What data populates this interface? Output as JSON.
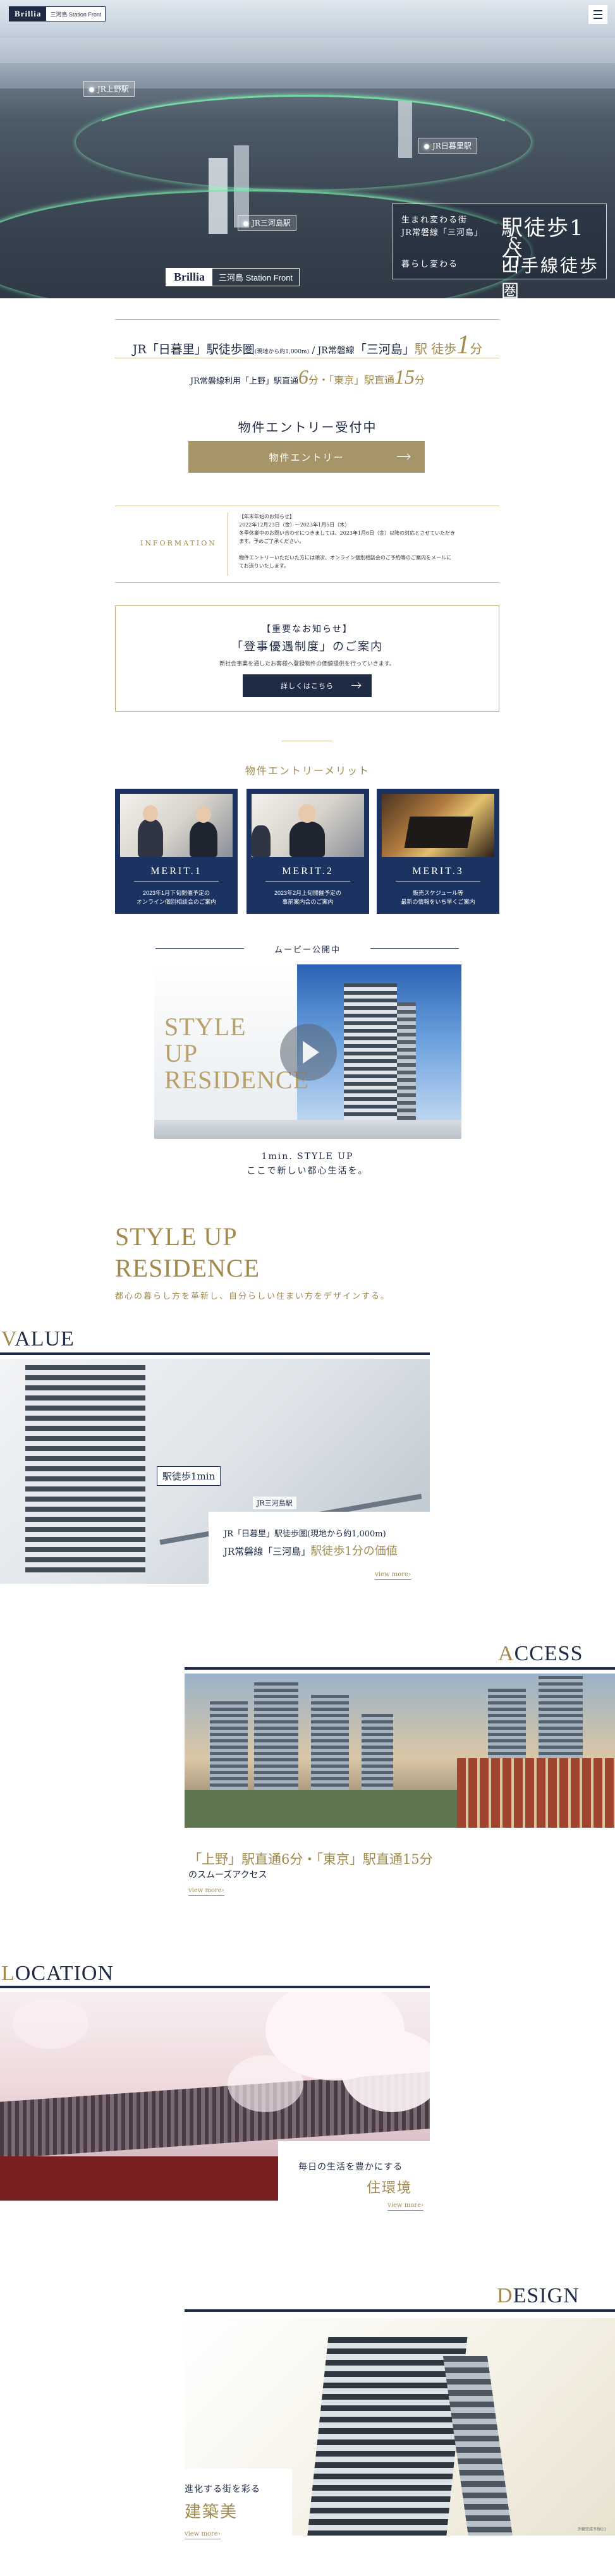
{
  "header": {
    "brand": "Brillia",
    "brand_sub": "三河島 Station Front",
    "menu_icon": "hamburger-icon"
  },
  "hero": {
    "stations": [
      "JR上野駅",
      "JR日暮里駅",
      "JR三河島駅"
    ],
    "copy_line1": "生まれ変わる街",
    "copy_line2": "JR常磐線「三河島」",
    "copy_big1": "駅徒歩1分",
    "copy_amp": "&",
    "copy_line3": "暮らし変わる",
    "copy_big2": "山手線徒歩圏",
    "brand": "Brillia",
    "brand_sub": "三河島 Station Front"
  },
  "access_line1": {
    "a": "JR「日暮里」駅徒歩圏",
    "a_note": "(現地から約1,000m)",
    "b": "/ JR常磐線",
    "c": "「三河島」",
    "d": "駅 徒歩",
    "e": "1",
    "f": "分"
  },
  "access_line2": {
    "a": "JR常磐線利用「上野」駅直通",
    "b": "6",
    "c": "分・「東京」駅直通",
    "d": "15",
    "e": "分"
  },
  "entry": {
    "heading": "物件エントリー受付中",
    "button_label": "物件エントリー"
  },
  "information": {
    "label": "INFORMATION",
    "lines": [
      "【年末年始のお知らせ】",
      "2022年12月23日（金）～2023年1月5日（木）",
      "冬季休業中のお問い合わせにつきましては、2023年1月6日（金）以降の対応とさせていただき",
      "ます。予めご了承ください。",
      "",
      "物件エントリーいただいた方には順次、オンライン個別相談会のご予約等のご案内をメールに",
      "てお送りいたします。"
    ]
  },
  "notice": {
    "small": "【重要なお知らせ】",
    "title": "「登事優遇制度」のご案内",
    "desc": "新社会事業を通したお客様へ登録物件の価値提供を行っていきます。",
    "button_label": "詳しくはこちら"
  },
  "merit": {
    "heading": "物件エントリーメリット",
    "items": [
      {
        "title": "MERIT.1",
        "d1": "2023年1月下旬開催予定の",
        "d2": "オンライン個別相談会のご案内"
      },
      {
        "title": "MERIT.2",
        "d1": "2023年2月上旬開催予定の",
        "d2": "事前案内会のご案内"
      },
      {
        "title": "MERIT.3",
        "d1": "販売スケジュール等",
        "d2": "最新の情報をいち早くご案内"
      }
    ]
  },
  "movie": {
    "heading": "ムービー公開中",
    "overlay": "STYLE\nUP\nRESIDENCE",
    "caption1": "1min. STYLE UP",
    "caption2": "ここで新しい都心生活を。"
  },
  "style_up": {
    "title_line1": "STYLE UP",
    "title_line2": "RESIDENCE",
    "sub": "都心の暮らし方を革新し、自分らしい住まい方をデザインする。"
  },
  "value": {
    "title_cap": "V",
    "title_rest": "ALUE",
    "tag": "駅徒歩1min",
    "tag2": "JR三河島駅",
    "c1": "JR「日暮里」駅徒歩圏(現地から約1,000m)",
    "c2a": "JR常磐線「三河島」",
    "c2b": "駅徒歩1分の価値",
    "more": "view more›"
  },
  "access": {
    "title_cap": "A",
    "title_rest": "CCESS",
    "c1": "「上野」駅直通6分・「東京」駅直通15分",
    "c2": "のスムーズアクセス",
    "more": "view more›"
  },
  "location": {
    "title_cap": "L",
    "title_rest": "OCATION",
    "c1": "毎日の生活を豊かにする",
    "c2": "住環境",
    "more": "view more›"
  },
  "design": {
    "title_cap": "D",
    "title_rest": "ESIGN",
    "c1": "進化する街を彩る",
    "c2": "建築美",
    "more": "view more›",
    "img_caption": "外観完成予想CG"
  }
}
